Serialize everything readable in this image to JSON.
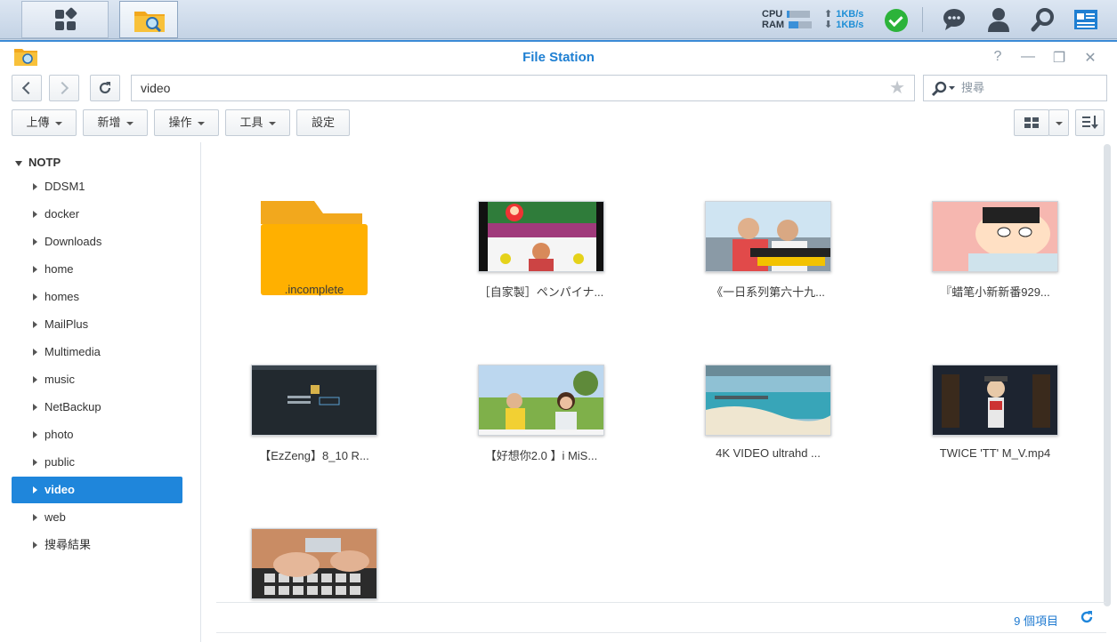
{
  "taskbar": {
    "cpu_label": "CPU",
    "ram_label": "RAM",
    "cpu_level": 0.1,
    "ram_level": 0.4,
    "upload": "1KB/s",
    "download": "1KB/s"
  },
  "window": {
    "title": "File Station",
    "help": "?"
  },
  "toolbar": {
    "path": "video",
    "search_placeholder": "搜尋",
    "upload": "上傳",
    "create": "新增",
    "action": "操作",
    "tools": "工具",
    "settings": "設定"
  },
  "sidebar": {
    "root": "NOTP",
    "items": [
      "DDSM1",
      "docker",
      "Downloads",
      "home",
      "homes",
      "MailPlus",
      "Multimedia",
      "music",
      "NetBackup",
      "photo",
      "public",
      "video",
      "web",
      "搜尋結果"
    ],
    "active": "video"
  },
  "files": [
    {
      "name": ".incomplete",
      "type": "folder"
    },
    {
      "name": "［自家製］ペンパイナ...",
      "type": "video"
    },
    {
      "name": "《一日系列第六十九...",
      "type": "video"
    },
    {
      "name": "『蜡笔小新新番929...",
      "type": "video"
    },
    {
      "name": "【EzZeng】8_10 R...",
      "type": "video"
    },
    {
      "name": "【好想你2.0 】i MiS...",
      "type": "video"
    },
    {
      "name": "4K VIDEO ultrahd ...",
      "type": "video"
    },
    {
      "name": "TWICE 'TT' M_V.mp4",
      "type": "video"
    },
    {
      "name": "",
      "type": "video"
    }
  ],
  "footer": {
    "count": "9 個項目"
  }
}
